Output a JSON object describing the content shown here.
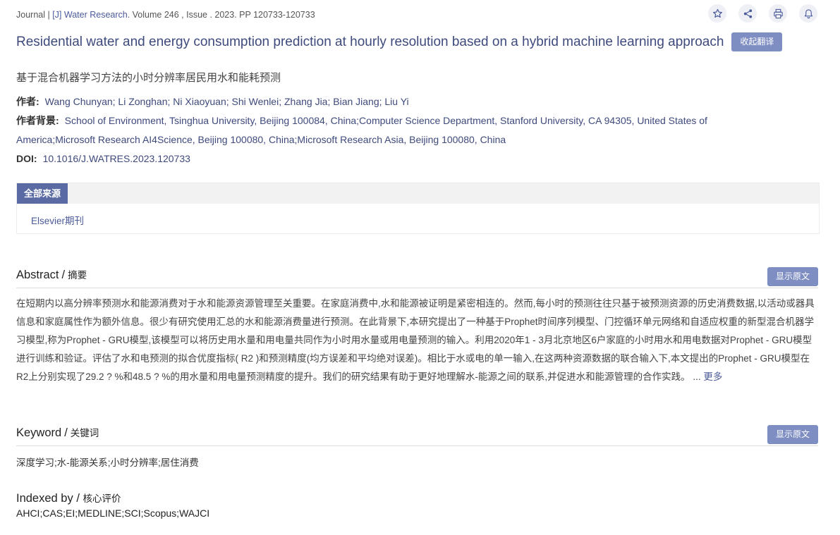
{
  "journal": {
    "prefix": "Journal | ",
    "name": "[J] Water Research",
    "rest": ". Volume 246 , Issue . 2023. PP 120733-120733"
  },
  "toolbar": {
    "icons": [
      "star-icon",
      "share-icon",
      "print-icon",
      "bell-icon"
    ]
  },
  "title": "Residential water and energy consumption prediction at hourly resolution based on a hybrid machine learning approach",
  "collapse_translation_label": "收起翻译",
  "title_cn": "基于混合机器学习方法的小时分辨率居民用水和能耗预测",
  "meta": {
    "authors_label": "作者:",
    "authors": "Wang Chunyan; Li Zonghan; Ni Xiaoyuan; Shi Wenlei; Zhang Jia; Bian Jiang; Liu Yi",
    "background_label": "作者背景:",
    "background": "School of Environment, Tsinghua University, Beijing 100084, China;Computer Science Department, Stanford University, CA 94305, United States of America;Microsoft Research AI4Science, Beijing 100080, China;Microsoft Research Asia, Beijing 100080, China",
    "doi_label": "DOI:",
    "doi": "10.1016/J.WATRES.2023.120733"
  },
  "sources": {
    "tab_label": "全部来源",
    "items": [
      "Elsevier期刊"
    ]
  },
  "abstract": {
    "title_en": "Abstract",
    "slash": "/",
    "title_cn": "摘要",
    "show_original_label": "显示原文",
    "text": "在短期内以高分辨率预测水和能源消费对于水和能源资源管理至关重要。在家庭消费中,水和能源被证明是紧密相连的。然而,每小时的预测往往只基于被预测资源的历史消费数据,以活动或器具信息和家庭属性作为额外信息。很少有研究使用汇总的水和能源消费量进行预测。在此背景下,本研究提出了一种基于Prophet时间序列模型、门控循环单元网络和自适应权重的新型混合机器学习模型,称为Prophet - GRU模型,该模型可以将历史用水量和用电量共同作为小时用水量或用电量预测的输入。利用2020年1 - 3月北京地区6户家庭的小时用水和用电数据对Prophet - GRU模型进行训练和验证。评估了水和电预测的拟合优度指标( R2 )和预测精度(均方误差和平均绝对误差)。相比于水或电的单一输入,在这两种资源数据的联合输入下,本文提出的Prophet - GRU模型在R2上分别实现了29.2 ? %和48.5 ? %的用水量和用电量预测精度的提升。我们的研究结果有助于更好地理解水-能源之间的联系,并促进水和能源管理的合作实践。",
    "ellipsis": " ... ",
    "more_label": "更多"
  },
  "keyword": {
    "title_en": "Keyword",
    "slash": "/",
    "title_cn": "关键词",
    "show_original_label": "显示原文",
    "text": "深度学习;水-能源关系;小时分辨率;居住消费"
  },
  "indexed": {
    "title_en": "Indexed by",
    "slash": "/",
    "title_cn": "核心评价",
    "text": "AHCI;CAS;EI;MEDLINE;SCI;Scopus;WAJCI"
  }
}
